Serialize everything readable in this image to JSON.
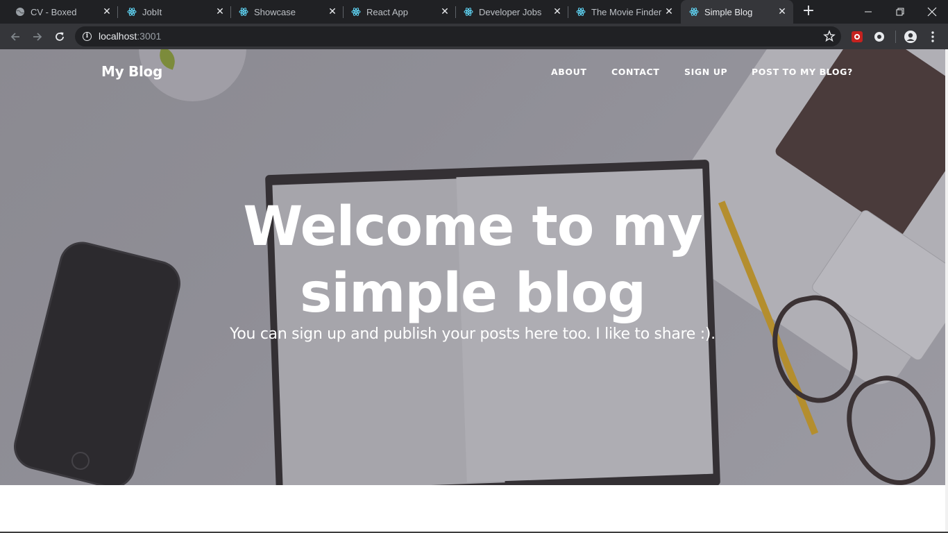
{
  "browser": {
    "tabs": [
      {
        "title": "CV - Boxed",
        "icon": "globe-icon",
        "active": false
      },
      {
        "title": "JobIt",
        "icon": "react-icon",
        "active": false
      },
      {
        "title": "Showcase",
        "icon": "react-icon",
        "active": false
      },
      {
        "title": "React App",
        "icon": "react-icon",
        "active": false
      },
      {
        "title": "Developer Jobs",
        "icon": "react-icon",
        "active": false
      },
      {
        "title": "The Movie Finder",
        "icon": "react-icon",
        "active": false
      },
      {
        "title": "Simple Blog",
        "icon": "react-icon",
        "active": true
      }
    ],
    "url_host": "localhost",
    "url_port": ":3001"
  },
  "site": {
    "brand": "My Blog",
    "nav": [
      "ABOUT",
      "CONTACT",
      "SIGN UP",
      "POST TO MY BLOG?"
    ]
  },
  "hero": {
    "title_line1": "Welcome to my",
    "title_line2": "simple blog",
    "subtitle": "You can sign up and publish your posts here too. I like to share :)."
  },
  "colors": {
    "tabstrip": "#202124",
    "toolbar": "#35363a",
    "react_icon": "#61dafb",
    "hero_overlay": "#8f8e96"
  }
}
